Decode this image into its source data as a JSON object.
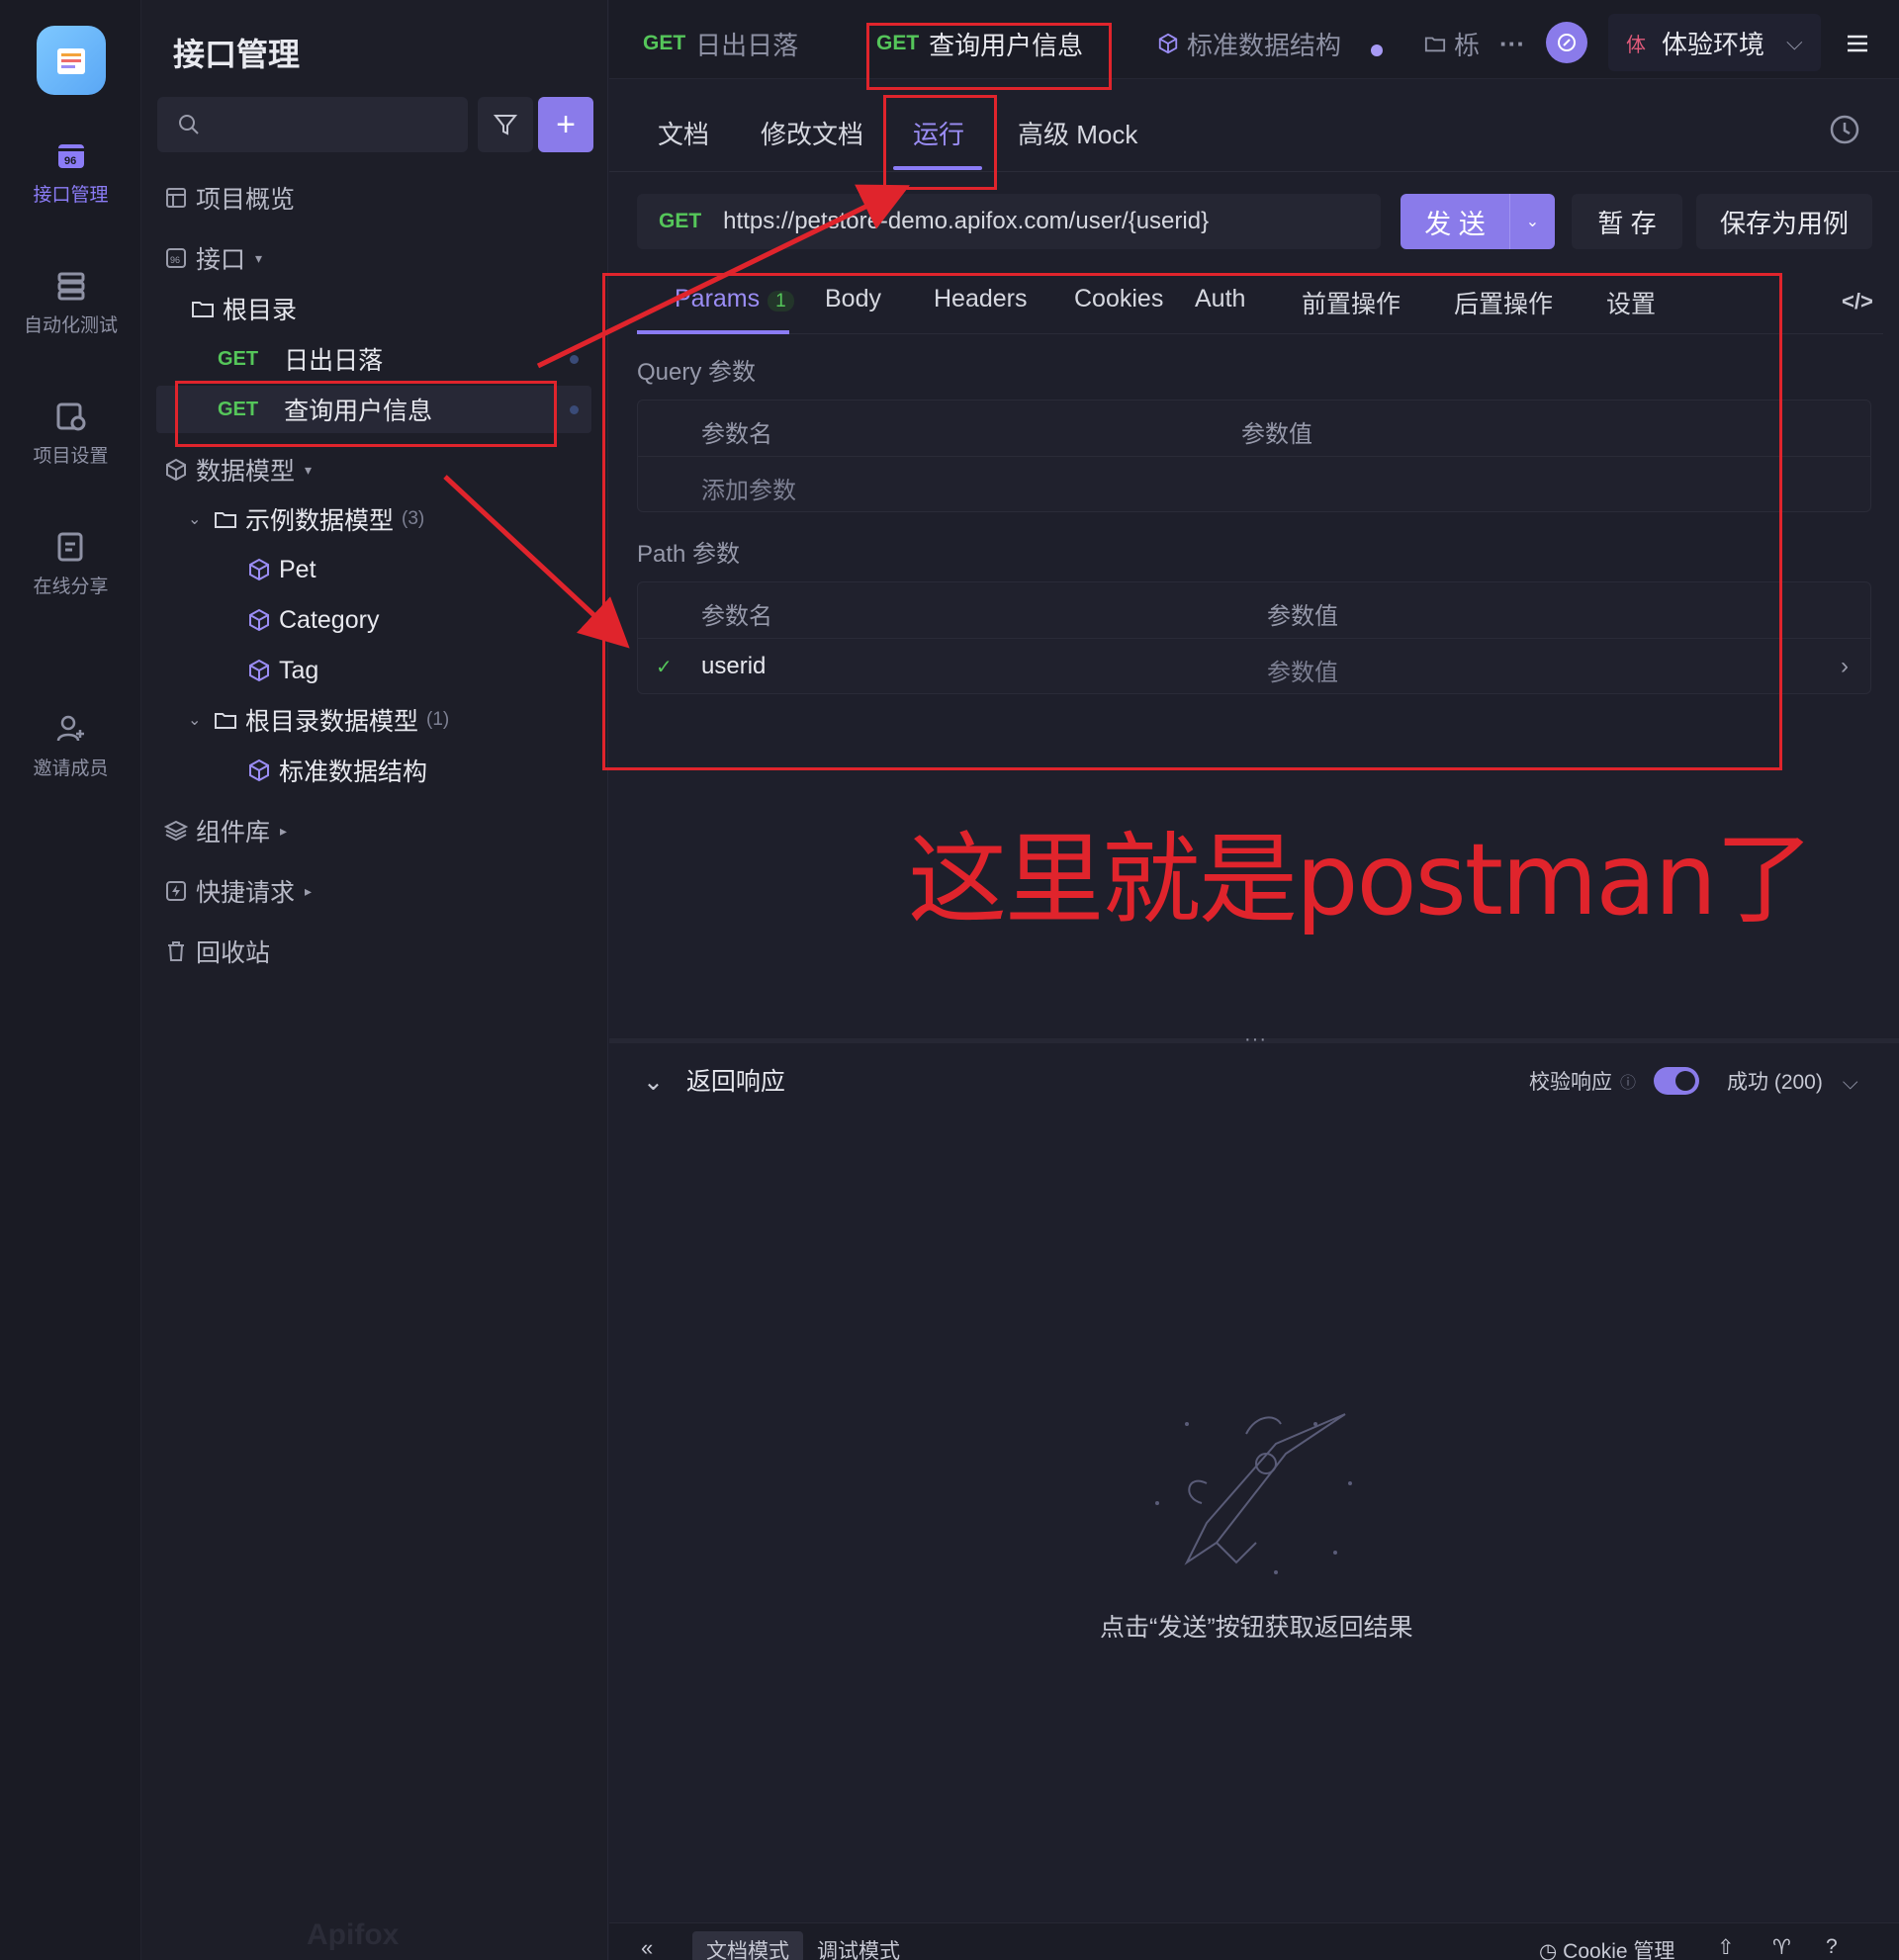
{
  "rail": {
    "items": [
      {
        "label": "接口管理",
        "icon": "api-icon"
      },
      {
        "label": "自动化测试",
        "icon": "stack-icon"
      },
      {
        "label": "项目设置",
        "icon": "settings-icon"
      },
      {
        "label": "在线分享",
        "icon": "share-icon"
      },
      {
        "label": "邀请成员",
        "icon": "user-plus-icon"
      }
    ]
  },
  "sidebar": {
    "title": "接口管理",
    "tree": {
      "overview": "项目概览",
      "api": "接口",
      "root": "根目录",
      "api1_method": "GET",
      "api1_name": "日出日落",
      "api2_method": "GET",
      "api2_name": "查询用户信息",
      "models": "数据模型",
      "example_models": "示例数据模型",
      "example_count": "(3)",
      "pet": "Pet",
      "category": "Category",
      "tag": "Tag",
      "root_models": "根目录数据模型",
      "root_count": "(1)",
      "std": "标准数据结构",
      "components": "组件库",
      "quick": "快捷请求",
      "trash": "回收站"
    },
    "brand": "Apifox"
  },
  "tabs": {
    "t1_method": "GET",
    "t1_name": "日出日落",
    "t2_method": "GET",
    "t2_name": "查询用户信息",
    "t3_name": "标准数据结构",
    "t4_name": "栎",
    "more": "···",
    "env_badge": "体",
    "env_name": "体验环境"
  },
  "subtabs": [
    "文档",
    "修改文档",
    "运行",
    "高级 Mock"
  ],
  "request": {
    "method": "GET",
    "url": "https://petstore-demo.apifox.com/user/{userid}",
    "send": "发 送",
    "save_temp": "暂 存",
    "save_case": "保存为用例"
  },
  "params_tabs": {
    "params": "Params",
    "params_count": "1",
    "body": "Body",
    "headers": "Headers",
    "cookies": "Cookies",
    "auth": "Auth",
    "pre": "前置操作",
    "post": "后置操作",
    "settings": "设置"
  },
  "query": {
    "label": "Query 参数",
    "col_name": "参数名",
    "col_value": "参数值",
    "add": "添加参数"
  },
  "path": {
    "label": "Path 参数",
    "col_name": "参数名",
    "col_value": "参数值",
    "row_name": "userid",
    "row_value_placeholder": "参数值"
  },
  "annotation": "这里就是postman了",
  "response": {
    "title": "返回响应",
    "verify": "校验响应",
    "status": "成功 (200)",
    "empty": "点击“发送”按钮获取返回结果"
  },
  "footer": {
    "doc_mode": "文档模式",
    "debug_mode": "调试模式",
    "cookie": "Cookie 管理"
  }
}
